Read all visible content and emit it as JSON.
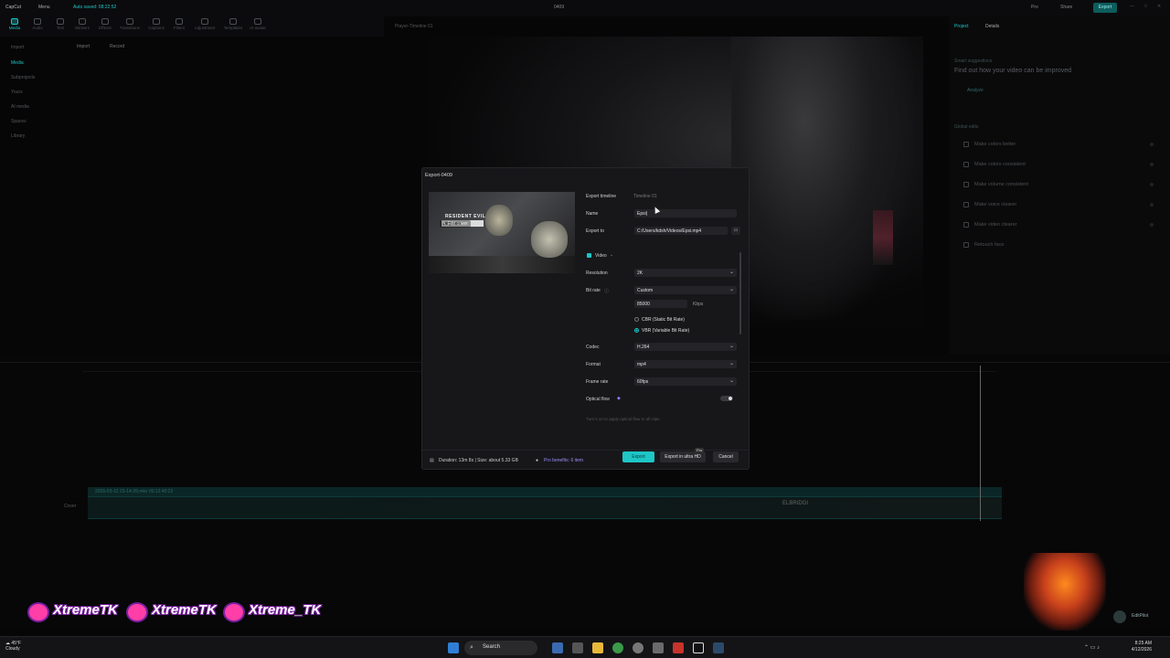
{
  "app": {
    "title_center": "0409",
    "menu": "Menu",
    "autosave": "Auto saved: 08:22:52",
    "pro": "Pro",
    "share": "Share",
    "export_top": "Export"
  },
  "tools": [
    "Media",
    "Audio",
    "Text",
    "Stickers",
    "Effects",
    "Transitions",
    "Captions",
    "Filters",
    "Adjustment",
    "Templates",
    "AI avatar"
  ],
  "left_nav": {
    "tabs": [
      "Import",
      "Record"
    ],
    "items": [
      "Import",
      "Media",
      "Subprojects",
      "Yours",
      "AI media",
      "Spaces",
      "Library"
    ]
  },
  "player": {
    "title": "Player-Timeline 01"
  },
  "right_panel": {
    "tab_project": "Project",
    "tab_details": "Details",
    "smart_suggestions": "Smart suggestions",
    "headline": "Find out how your video can be improved",
    "analyze": "Analyze",
    "global_edits": "Global edits",
    "items": [
      "Make colors better",
      "Make colors consistent",
      "Make volume consistent",
      "Make voice clearer",
      "Make video clearer",
      "Retouch face"
    ]
  },
  "timeline": {
    "clip_label": "2026-03-12 23-14-39.mkv   00:12:40:22",
    "cover": "Cover",
    "clip_text": "ELBRIDGI"
  },
  "dialog": {
    "title": "Export-0409",
    "edit_cover": "Edit cover",
    "thumb_title": "RESIDENT EVIL",
    "thumb_sub": "requiem",
    "export_timeline_label": "Export timeline",
    "export_timeline_value": "Timeline 01",
    "name_label": "Name",
    "name_value": "Epsi|",
    "export_to_label": "Export to",
    "export_to_value": "C:/Users/kdsh/Videos/Epsi.mp4",
    "video_label": "Video",
    "resolution_label": "Resolution",
    "resolution_value": "2K",
    "bitrate_label": "Bit rate",
    "bitrate_value": "Custom",
    "bitrate_number": "85000",
    "kbps": "Kbps",
    "cbr": "CBR (Static Bit Rate)",
    "vbr": "VBR (Variable Bit Rate)",
    "codec_label": "Codec",
    "codec_value": "H.264",
    "format_label": "Format",
    "format_value": "mp4",
    "framerate_label": "Frame rate",
    "framerate_value": "60fps",
    "optical_flow_label": "Optical flow",
    "optical_flow_hint": "Turn it on to apply optical flow to all clips.",
    "footer_info": "Duration: 13m 8s | Size: about 5.33 GB",
    "pro_benefits": "Pro benefits: 6 item",
    "btn_export": "Export",
    "btn_ultra": "Export in ultra HD",
    "ultra_badge": "Pro",
    "btn_cancel": "Cancel"
  },
  "overlay": {
    "handle1": "XtremeTK",
    "handle2": "XtremeTK",
    "handle3": "Xtreme_TK",
    "editpilot": "EditPilot"
  },
  "taskbar": {
    "temp": "45°F",
    "weather": "Cloudy",
    "search": "Search",
    "time": "8:25 AM",
    "date": "4/12/2026"
  },
  "colors": {
    "accent": "#1ec6c6",
    "dialog_bg": "#17171a",
    "brand_pink": "#ff3ea8"
  }
}
